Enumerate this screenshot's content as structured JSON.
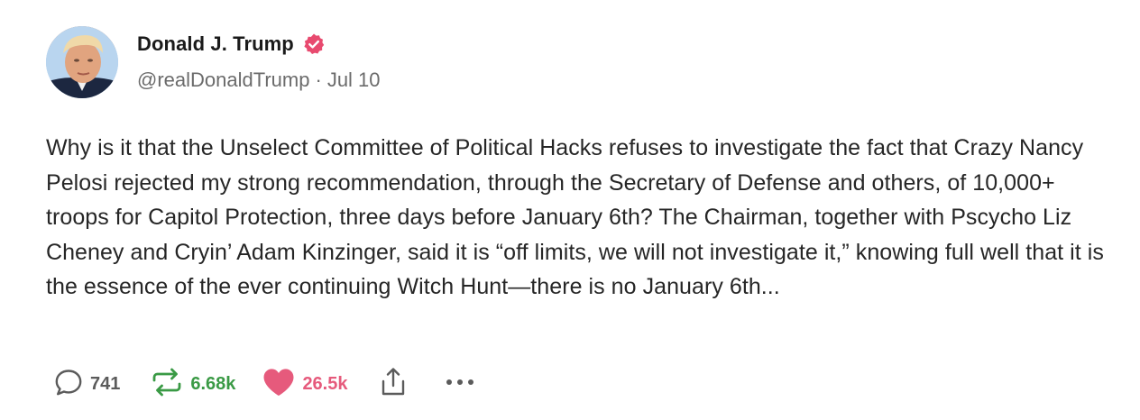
{
  "author": {
    "display_name": "Donald J. Trump",
    "handle": "@realDonaldTrump",
    "separator": "·",
    "date": "Jul 10",
    "verified": true
  },
  "post": {
    "text": "Why is it that the Unselect Committee of Political Hacks refuses to investigate the fact that Crazy Nancy Pelosi rejected my strong recommendation, through the Secretary of Defense and others, of 10,000+ troops for Capitol Protection, three days before January 6th? The Chairman, together with Pscycho Liz Cheney and Cryin’ Adam Kinzinger, said it is “off limits, we will not investigate it,” knowing full well that it is the essence of the ever continuing Witch Hunt—there is no January 6th..."
  },
  "actions": {
    "replies": "741",
    "retruths": "6.68k",
    "likes": "26.5k"
  },
  "icons": {
    "verified": "verified-badge-icon",
    "reply": "speech-bubble-icon",
    "retruth": "retruth-arrows-icon",
    "like": "heart-icon",
    "share": "share-icon",
    "more": "ellipsis-icon"
  },
  "colors": {
    "verified_badge": "#e84a6f",
    "retruth_green": "#3a9a45",
    "like_pink": "#e65a7c",
    "muted_text": "#6b6b6b"
  }
}
